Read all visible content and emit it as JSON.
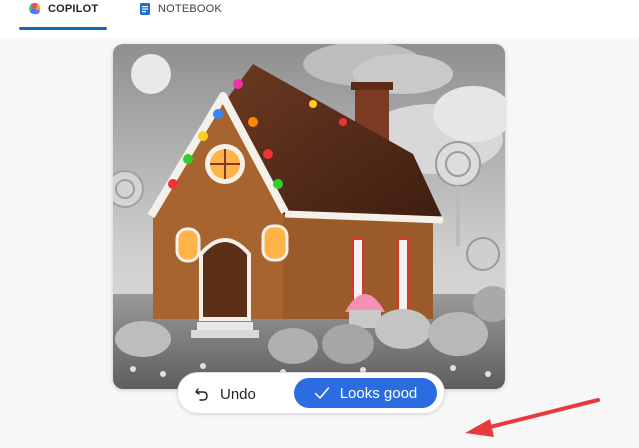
{
  "tabs": [
    {
      "label": "COPILOT",
      "icon": "copilot-logo-icon",
      "active": true
    },
    {
      "label": "NOTEBOOK",
      "icon": "notebook-icon",
      "active": false
    }
  ],
  "image": {
    "subject": "Gingerbread house with candy decorations in a grayscale candy landscape"
  },
  "actions": {
    "undo_label": "Undo",
    "undo_icon": "undo-icon",
    "confirm_label": "Looks good",
    "confirm_icon": "checkmark-icon"
  },
  "colors": {
    "accent": "#0f6cbd",
    "confirm_button": "#2b6de0",
    "annotation_arrow": "#e8393f"
  }
}
